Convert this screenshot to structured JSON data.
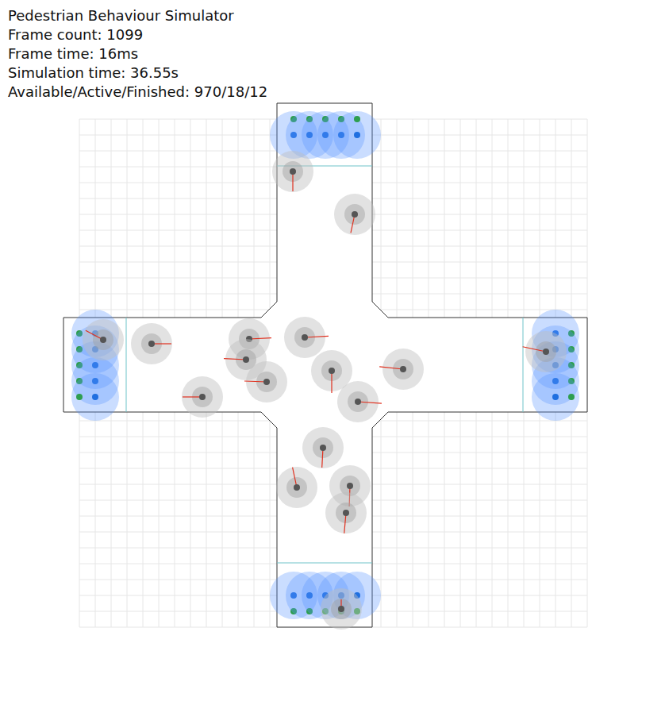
{
  "window": {
    "title": "Pedestrian Behaviour Simulator"
  },
  "stats": [
    "Frame count: 1099",
    "Frame time: 16ms",
    "Simulation time: 36.55s",
    "Available/Active/Finished: 970/18/12"
  ]
}
